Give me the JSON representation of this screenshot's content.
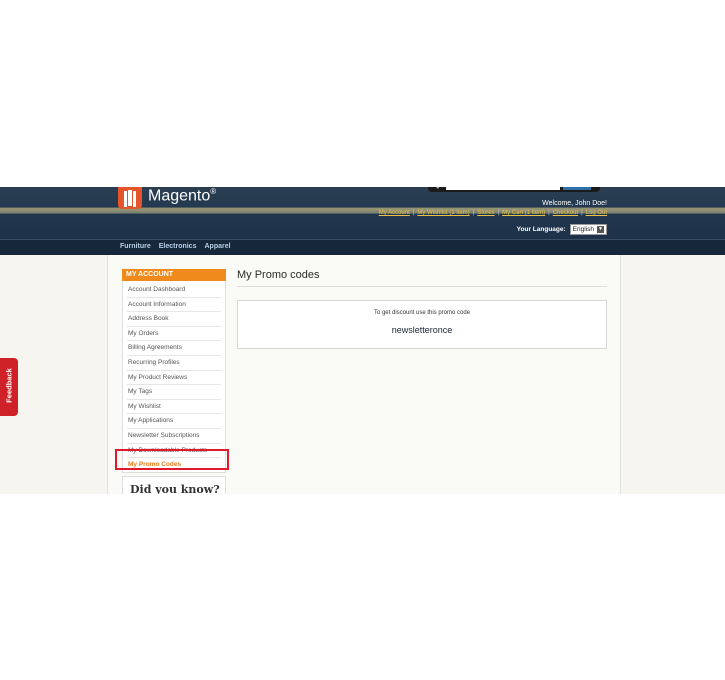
{
  "header": {
    "logo_text": "Magento",
    "logo_mark": "®",
    "welcome": "Welcome, John Doe!",
    "links": [
      "My Account",
      "My Wishlist (1 item)",
      "Stores",
      "My Cart (1 item)",
      "Checkout",
      "Log Out"
    ],
    "language_label": "Your Language:",
    "language_value": "English"
  },
  "nav": {
    "items": [
      "Furniture",
      "Electronics",
      "Apparel"
    ]
  },
  "sidebar": {
    "title": "MY ACCOUNT",
    "items": [
      "Account Dashboard",
      "Account Information",
      "Address Book",
      "My Orders",
      "Billing Agreements",
      "Recurring Profiles",
      "My Product Reviews",
      "My Tags",
      "My Wishlist",
      "My Applications",
      "Newsletter Subscriptions",
      "My Downloadable Products",
      "My Promo Codes"
    ],
    "did_you_know": "Did you know?"
  },
  "main": {
    "title": "My Promo codes",
    "promo_label": "To get discount use this promo code",
    "promo_code": "newsletteronce"
  },
  "feedback": {
    "label": "Feedback"
  },
  "colors": {
    "accent": "#f18a1c",
    "highlight": "#e0192d",
    "feedback": "#cf2128"
  }
}
